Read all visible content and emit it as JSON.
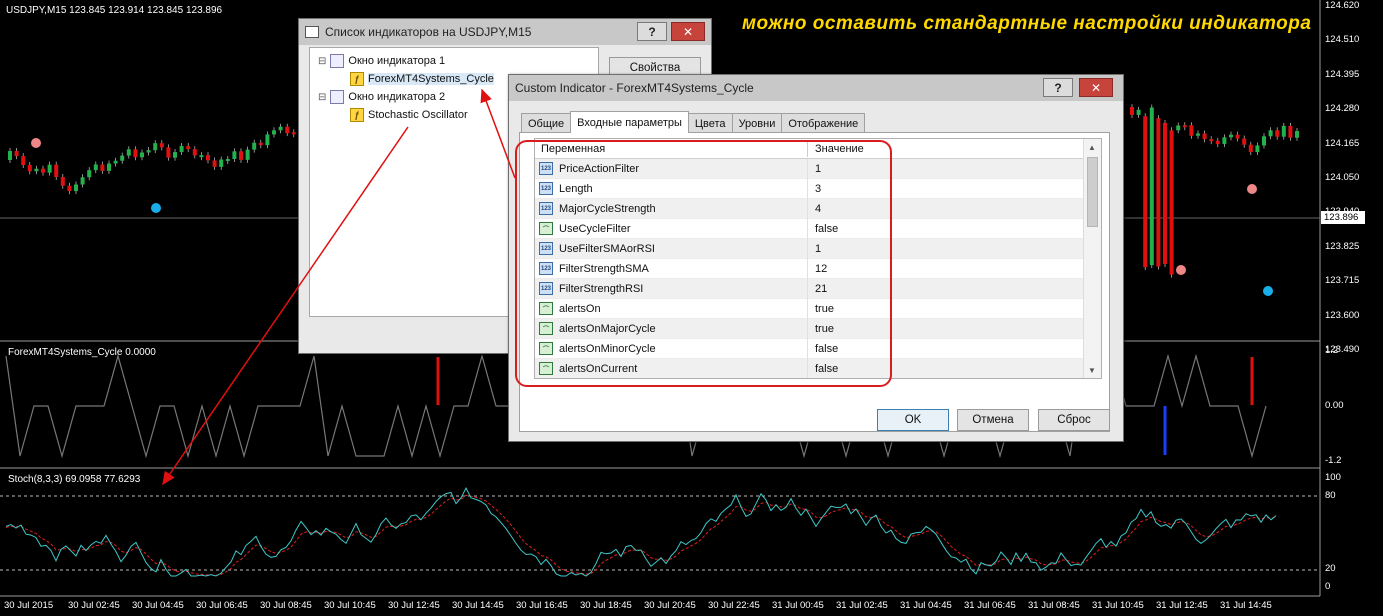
{
  "chart": {
    "symbol_header": "USDJPY,M15  123.845 123.914 123.845 123.896",
    "current_price": "123.896",
    "price_axis": [
      "124.620",
      "124.510",
      "124.395",
      "124.280",
      "124.165",
      "124.050",
      "123.940",
      "123.825",
      "123.715",
      "123.600",
      "123.490"
    ],
    "cycle_header": "ForexMT4Systems_Cycle 0.0000",
    "cycle_axis": [
      "1.2",
      "0.00",
      "-1.2"
    ],
    "stoch_header": "Stoch(8,3,3) 69.0958 77.6293",
    "stoch_axis": [
      "100",
      "80",
      "20",
      "0"
    ],
    "time_axis": [
      "30 Jul 2015",
      "30 Jul 02:45",
      "30 Jul 04:45",
      "30 Jul 06:45",
      "30 Jul 08:45",
      "30 Jul 10:45",
      "30 Jul 12:45",
      "30 Jul 14:45",
      "30 Jul 16:45",
      "30 Jul 18:45",
      "30 Jul 20:45",
      "30 Jul 22:45",
      "31 Jul 00:45",
      "31 Jul 02:45",
      "31 Jul 04:45",
      "31 Jul 06:45",
      "31 Jul 08:45",
      "31 Jul 10:45",
      "31 Jul 12:45",
      "31 Jul 14:45"
    ],
    "colors": {
      "bull": "#22b14c",
      "bear": "#e01010",
      "stoch_main": "#3fc8c8",
      "stoch_signal": "#e02020",
      "cycle_up": "#e01010",
      "cycle_down": "#1a3cff",
      "cycle_line": "#777777"
    }
  },
  "annotation": "можно оставить стандартные настройки индикатора",
  "indicator_list": {
    "title": "Список индикаторов на USDJPY,M15",
    "help_button": "?",
    "close_button": "✕",
    "properties_button": "Свойства",
    "tree": [
      {
        "label": "Окно индикатора 1",
        "toggle": "⊟"
      },
      {
        "label": "ForexMT4Systems_Cycle"
      },
      {
        "label": "Окно индикатора 2",
        "toggle": "⊟"
      },
      {
        "label": "Stochastic Oscillator"
      }
    ]
  },
  "custom_indicator": {
    "title": "Custom Indicator - ForexMT4Systems_Cycle",
    "help_button": "?",
    "close_button": "✕",
    "tabs": [
      "Общие",
      "Входные параметры",
      "Цвета",
      "Уровни",
      "Отображение"
    ],
    "columns": [
      "Переменная",
      "Значение"
    ],
    "params": [
      {
        "name": "PriceActionFilter",
        "value": "1",
        "kind": "num"
      },
      {
        "name": "Length",
        "value": "3",
        "kind": "num"
      },
      {
        "name": "MajorCycleStrength",
        "value": "4",
        "kind": "num"
      },
      {
        "name": "UseCycleFilter",
        "value": "false",
        "kind": "bool"
      },
      {
        "name": "UseFilterSMAorRSI",
        "value": "1",
        "kind": "num"
      },
      {
        "name": "FilterStrengthSMA",
        "value": "12",
        "kind": "num"
      },
      {
        "name": "FilterStrengthRSI",
        "value": "21",
        "kind": "num"
      },
      {
        "name": "alertsOn",
        "value": "true",
        "kind": "bool"
      },
      {
        "name": "alertsOnMajorCycle",
        "value": "true",
        "kind": "bool"
      },
      {
        "name": "alertsOnMinorCycle",
        "value": "false",
        "kind": "bool"
      },
      {
        "name": "alertsOnCurrent",
        "value": "false",
        "kind": "bool"
      }
    ],
    "num_icon_text": "123",
    "ok_button": "OK",
    "cancel_button": "Отмена",
    "reset_button": "Сброс"
  }
}
